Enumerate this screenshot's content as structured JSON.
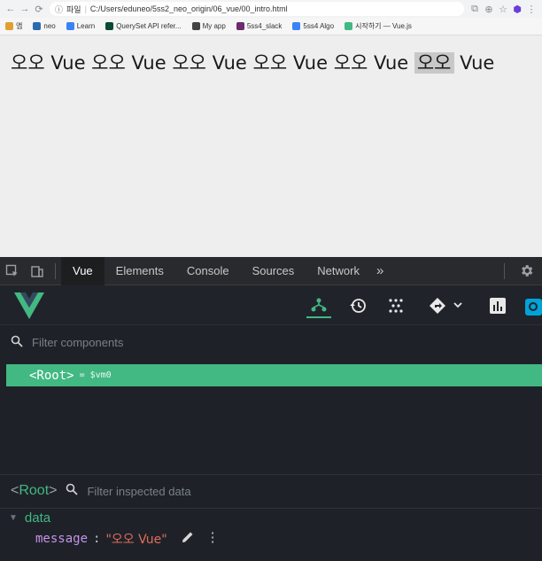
{
  "browser": {
    "url_label": "파일",
    "url": "C:/Users/eduneo/5ss2_neo_origin/06_vue/00_intro.html",
    "bookmarks": [
      {
        "label": "앱",
        "color": "#e0a030"
      },
      {
        "label": "neo",
        "color": "#2b6cb0"
      },
      {
        "label": "Learn",
        "color": "#3b82f6"
      },
      {
        "label": "QuerySet API refer...",
        "color": "#0c4b33"
      },
      {
        "label": "My app",
        "color": "#444444"
      },
      {
        "label": "5ss4_slack",
        "color": "#6b2d6b"
      },
      {
        "label": "5ss4 Algo",
        "color": "#3b82f6"
      },
      {
        "label": "시작하기 — Vue.js",
        "color": "#42b883"
      }
    ]
  },
  "page": {
    "segments": [
      "오오 Vue",
      "오오 Vue",
      "오오 Vue",
      "오오 Vue",
      "오오 Vue"
    ],
    "highlight": "오오",
    "tail": "Vue"
  },
  "devtools": {
    "tabs": [
      "Vue",
      "Elements",
      "Console",
      "Sources",
      "Network"
    ],
    "more": "»",
    "active_tab": "Vue"
  },
  "vue": {
    "filter_components_placeholder": "Filter components",
    "root_label": "<Root>",
    "root_vm": "= $vm0",
    "inspected_root_open": "<",
    "inspected_root_name": "Root",
    "inspected_root_close": ">",
    "filter_inspected_placeholder": "Filter inspected data",
    "section": "data",
    "prop_key": "message",
    "prop_value": "\"오오 Vue\"",
    "accent": "#42b883"
  }
}
